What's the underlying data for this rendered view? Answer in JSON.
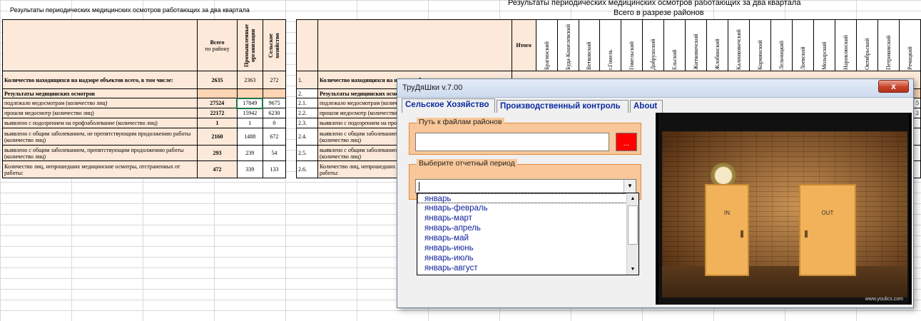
{
  "left_sheet": {
    "title": "Результаты периодических медицинских осмотров работающих за два квартала",
    "header": {
      "total_label": "Всего",
      "total_sub": "по району",
      "col1": "Промышленные организации",
      "col2": "Сельское хозяйство"
    },
    "rows": [
      {
        "label": "Количество  находящихся на надзоре объектов всего, в том числе:",
        "total": "2635",
        "c1": "2363",
        "c2": "272"
      },
      {
        "label": "Результаты медицинских осмотров",
        "total": "",
        "c1": "",
        "c2": ""
      },
      {
        "label": "подлежало медосмотрам (количество лиц)",
        "total": "27524",
        "c1": "17849",
        "c2": "9675"
      },
      {
        "label": "прошли медосмотр (количество лиц)",
        "total": "22172",
        "c1": "15942",
        "c2": "6230"
      },
      {
        "label": "выявлено с подозрением на профзаболевание (количество лиц)",
        "total": "1",
        "c1": "1",
        "c2": "0"
      },
      {
        "label": "выявлено с общим заболеванием, не препятствующим продолжению работы (количество лиц)",
        "total": "2160",
        "c1": "1488",
        "c2": "672"
      },
      {
        "label": "выявлено с общим заболеванием,  препятствующим продолжению работы (количество лиц)",
        "total": "293",
        "c1": "239",
        "c2": "54"
      },
      {
        "label": "Количество лиц, непрошедших медицинские осмотры, отстраненных от работы:",
        "total": "472",
        "c1": "339",
        "c2": "133"
      }
    ]
  },
  "right_sheet": {
    "title": "Результаты периодических медицинских осмотров работающих за два квартала",
    "subtitle": "Всего в разрезе районов",
    "itogo": "Итого",
    "districts": [
      "Брагинский",
      "Буда-Кошелевский",
      "Ветковский",
      "г.Гомель",
      "Гомельский",
      "Добрушский",
      "Ельский",
      "Житковичский",
      "Жлобинский",
      "Калинковичский",
      "Кормянский",
      "Лельчицкий",
      "Лоевский",
      "Мозырский",
      "Наровлянский",
      "Октябрьский",
      "Петриковский",
      "Речицкий"
    ],
    "row_numbers": [
      "1.",
      "2.",
      "2.1.",
      "2.2.",
      "2.3.",
      "2.4.",
      "2.5.",
      "2.6."
    ],
    "rows": [
      "Количество  находящихся на надзоре объектов всего, в том числе:",
      "Результаты медицинских осмотров",
      "подлежало медосмотрам (количество лиц)",
      "прошли медосмотр (количество лиц)",
      "выявлено с подозрением на профзаболевание (количество лиц)",
      "выявлено с общим заболеванием, не препятствующим продолжению работы (количество лиц)",
      "выявлено с общим заболеванием,  препятствующим продолжению работы (количество лиц)",
      "Количество лиц, непрошедших медицинские осмотры, отстраненных от работы:"
    ],
    "edge_values": [
      "5",
      "2"
    ]
  },
  "dialog": {
    "title": "ТруДяШки v.7.00",
    "close": "x",
    "tabs": [
      "Сельское Хозяйство",
      "Производственный контроль",
      "About"
    ],
    "path_label": "Путь к файлам районов",
    "path_value": "",
    "browse_label": "...",
    "period_label": "Выберите отчетный период",
    "period_value": "",
    "period_options": [
      "январь",
      "январь-февраль",
      "январь-март",
      "январь-апрель",
      "январь-май",
      "январь-июнь",
      "январь-июль",
      "январь-август"
    ],
    "picture": {
      "door_left": "IN",
      "door_right": "OUT",
      "credit": "www.youlics.com"
    }
  },
  "colors": {
    "peach": "#fde9d9",
    "orange": "#fcd5b4",
    "dialog_frame": "#f9c799",
    "link_blue": "#12229c"
  }
}
